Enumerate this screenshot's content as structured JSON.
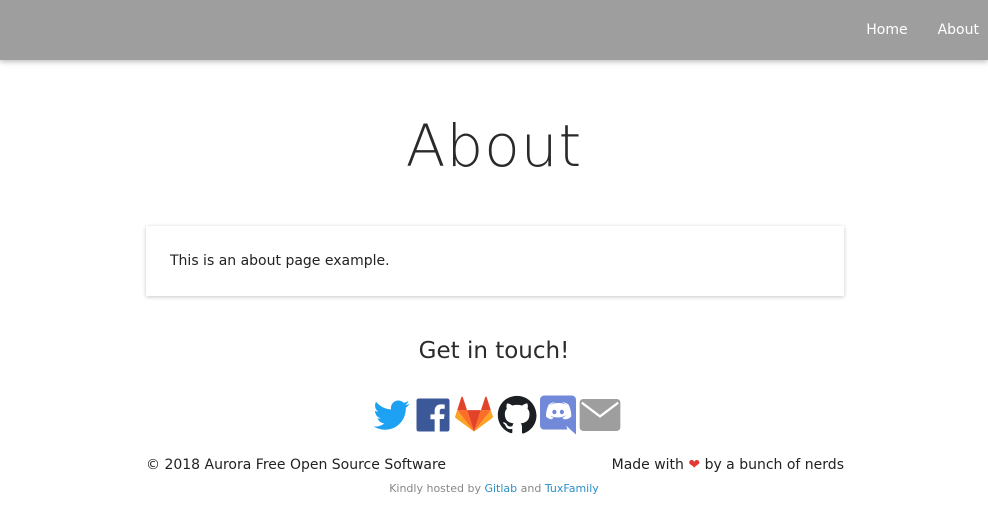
{
  "nav": {
    "links": [
      {
        "label": "Home"
      },
      {
        "label": "About"
      }
    ]
  },
  "page": {
    "title": "About",
    "card_text": "This is an about page example."
  },
  "contact": {
    "heading": "Get in touch!",
    "icons": [
      "twitter-icon",
      "facebook-icon",
      "gitlab-icon",
      "github-icon",
      "discord-icon",
      "email-icon"
    ]
  },
  "footer": {
    "copyright": "© 2018 Aurora Free Open Source Software",
    "made_with_prefix": "Made with",
    "heart": "❤",
    "made_with_suffix": "by a bunch of nerds",
    "hosted_prefix": "Kindly hosted by",
    "hosted_link1": "Gitlab",
    "hosted_and": "and",
    "hosted_link2": "TuxFamily"
  },
  "colors": {
    "navbar": "#9e9e9e",
    "twitter": "#1da1f2",
    "facebook": "#3b5998",
    "gitlab": "#fc6d26",
    "github": "#1b1f23",
    "discord": "#7289da",
    "email": "#9e9e9e",
    "heart": "#e53935",
    "link": "#2b8fc7"
  }
}
